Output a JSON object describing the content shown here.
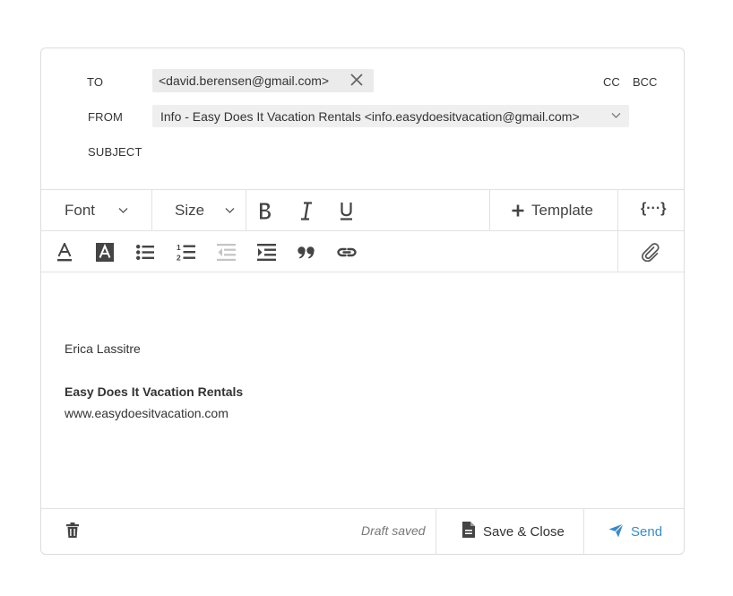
{
  "header": {
    "to_label": "TO",
    "to_recipient": "<david.berensen@gmail.com>",
    "cc_label": "CC",
    "bcc_label": "BCC",
    "from_label": "FROM",
    "from_value": "Info - Easy Does It Vacation Rentals <info.easydoesitvacation@gmail.com>",
    "subject_label": "SUBJECT",
    "subject_value": ""
  },
  "toolbar": {
    "font_label": "Font",
    "size_label": "Size",
    "template_label": "Template",
    "variables_label": "{···}",
    "icons": [
      "bold-icon",
      "italic-icon",
      "underline-icon",
      "plus-icon",
      "text-color-icon",
      "highlight-icon",
      "bulleted-list-icon",
      "numbered-list-icon",
      "outdent-icon",
      "indent-icon",
      "quote-icon",
      "link-icon",
      "paperclip-icon"
    ]
  },
  "body": {
    "signature_name": "Erica Lassitre",
    "signature_company": "Easy Does It Vacation Rentals",
    "signature_website": "www.easydoesitvacation.com"
  },
  "footer": {
    "draft_status": "Draft saved",
    "save_close_label": "Save & Close",
    "send_label": "Send"
  },
  "colors": {
    "accent": "#3a8cc4",
    "chip_bg": "#ebebeb",
    "border": "#dcdcdc",
    "icon": "#444444",
    "icon_disabled": "#c4c4c4"
  }
}
